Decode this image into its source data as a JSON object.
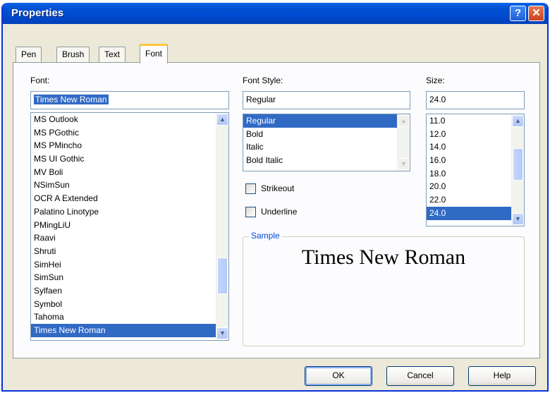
{
  "window": {
    "title": "Properties",
    "help_button": "?",
    "close_button": "✕"
  },
  "tabs": [
    {
      "label": "Pen",
      "selected": false
    },
    {
      "label": "Brush",
      "selected": false
    },
    {
      "label": "Text",
      "selected": false
    },
    {
      "label": "Font",
      "selected": true
    }
  ],
  "font": {
    "label": "Font:",
    "value": "Times New Roman",
    "items": [
      "MS Outlook",
      "MS PGothic",
      "MS PMincho",
      "MS UI Gothic",
      "MV Boli",
      "NSimSun",
      "OCR A Extended",
      "Palatino Linotype",
      "PMingLiU",
      "Raavi",
      "Shruti",
      "SimHei",
      "SimSun",
      "Sylfaen",
      "Symbol",
      "Tahoma",
      "Times New Roman"
    ],
    "selected": "Times New Roman"
  },
  "font_style": {
    "label": "Font Style:",
    "value": "Regular",
    "items": [
      "Regular",
      "Bold",
      "Italic",
      "Bold Italic"
    ],
    "selected": "Regular"
  },
  "size": {
    "label": "Size:",
    "value": "24.0",
    "items": [
      "11.0",
      "12.0",
      "14.0",
      "16.0",
      "18.0",
      "20.0",
      "22.0",
      "24.0"
    ],
    "selected": "24.0"
  },
  "effects": {
    "strikeout": {
      "label": "Strikeout",
      "checked": false
    },
    "underline": {
      "label": "Underline",
      "checked": false
    }
  },
  "sample": {
    "legend": "Sample",
    "text": "Times New Roman"
  },
  "buttons": {
    "ok": "OK",
    "cancel": "Cancel",
    "help": "Help"
  },
  "icons": {
    "scroll_up": "chevron-up-icon",
    "scroll_down": "chevron-down-icon"
  },
  "colors": {
    "title_bar": "#0050d0",
    "selection": "#316ac5",
    "sample_legend": "#0046d5",
    "tab_highlight": "#ffc73c"
  }
}
